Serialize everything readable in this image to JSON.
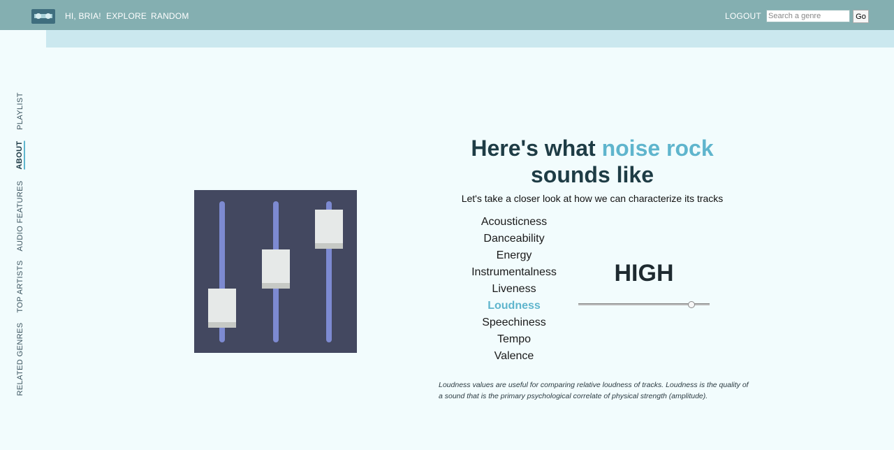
{
  "nav": {
    "logo_icon": "cassette-tape-icon",
    "greeting": "HI, BRIA!",
    "explore": "EXPLORE",
    "random": "RANDOM",
    "logout": "LOGOUT",
    "search_placeholder": "Search a genre",
    "go": "Go"
  },
  "sidebar": {
    "items": [
      "PLAYLIST",
      "ABOUT",
      "AUDIO FEATURES",
      "TOP ARTISTS",
      "RELATED GENRES"
    ],
    "active": "ABOUT"
  },
  "illustration": {
    "icon": "mixer-sliders-icon"
  },
  "headline": {
    "prefix": "Here's what ",
    "genre": "noise rock",
    "suffix": "sounds like"
  },
  "subline": "Let's take a closer look at how we can characterize its tracks",
  "features": {
    "items": [
      "Acousticness",
      "Danceability",
      "Energy",
      "Instrumentalness",
      "Liveness",
      "Loudness",
      "Speechiness",
      "Tempo",
      "Valence"
    ],
    "selected": "Loudness"
  },
  "level": {
    "label": "HIGH",
    "slider_value": 0.86
  },
  "description": "Loudness values are useful for comparing relative loudness of tracks. Loudness is the quality of a sound that is the primary psychological correlate of physical strength (amplitude).",
  "colors": {
    "topbar": "#84afb1",
    "accent": "#5fb5cd",
    "background": "#f2fcfd"
  }
}
